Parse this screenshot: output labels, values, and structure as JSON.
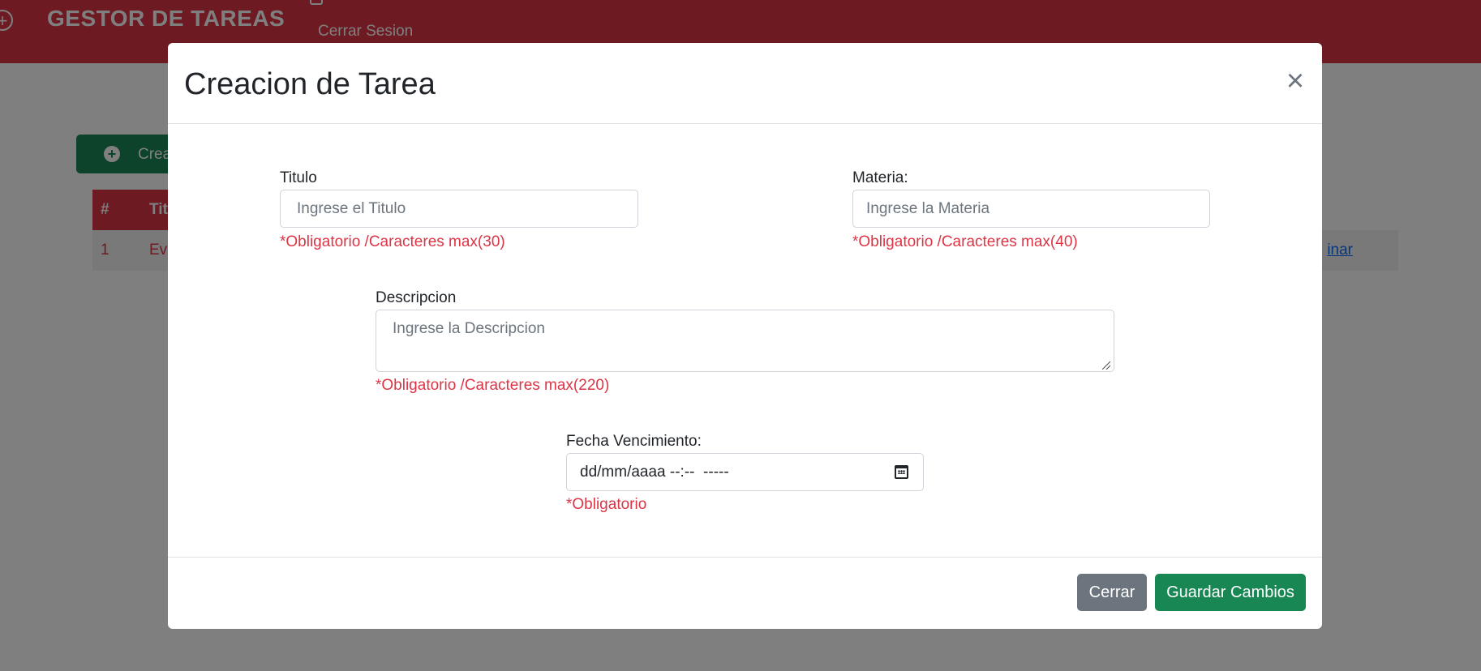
{
  "navbar": {
    "brand": "GESTOR DE TAREAS",
    "logout": "Cerrar Sesion"
  },
  "page": {
    "create_button": "Crea",
    "table": {
      "headers": [
        "#",
        "Tit"
      ],
      "row": {
        "number": "1",
        "title": "Evi",
        "action": "inar"
      }
    }
  },
  "modal": {
    "title": "Creacion de Tarea",
    "close_symbol": "×",
    "fields": {
      "titulo": {
        "label": "Titulo",
        "placeholder": "Ingrese el Titulo",
        "hint": "*Obligatorio /Caracteres max(30)"
      },
      "materia": {
        "label": "Materia:",
        "placeholder": "Ingrese la Materia",
        "hint": "*Obligatorio /Caracteres max(40)"
      },
      "descripcion": {
        "label": "Descripcion",
        "placeholder": "Ingrese la Descripcion",
        "hint": "*Obligatorio /Caracteres max(220)"
      },
      "fecha": {
        "label": "Fecha Vencimiento:",
        "value_display": "dd/mm/aaaa --:--  -----",
        "hint": "*Obligatorio"
      }
    },
    "footer": {
      "close_label": "Cerrar",
      "save_label": "Guardar Cambios"
    }
  },
  "colors": {
    "navbar": "#dc3545",
    "danger": "#dc3545",
    "success": "#198754",
    "secondary": "#6c757d",
    "link": "#0d6efd"
  }
}
